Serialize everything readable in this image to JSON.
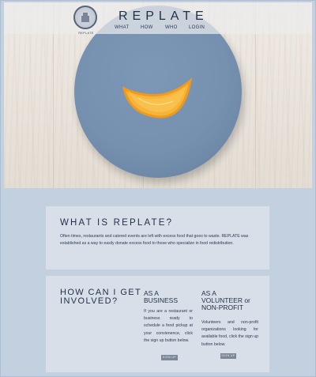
{
  "brand": {
    "name": "REPLATE",
    "logo_text": "REPLATE"
  },
  "nav": {
    "items": [
      "WHAT",
      "HOW",
      "WHO",
      "LOGIN"
    ]
  },
  "what": {
    "title": "WHAT IS REPLATE?",
    "body": "Often times, restaurants and catered events are left with excess food that goes to waste. REPLATE was established as a way to easily donate excess food to those who specialize in food redistribution."
  },
  "how": {
    "title_line1": "HOW CAN I GET",
    "title_line2": "INVOLVED?",
    "business": {
      "title_line1": "AS A",
      "title_line2": "BUSINESS",
      "body": "If you are a restaurant or business ready to schedule a food pickup at your convienence, click the sign up button below.",
      "button": "SIGN UP"
    },
    "volunteer": {
      "title_line1": "AS A",
      "title_line2": "VOLUNTEER or",
      "title_line3": "NON-PROFIT",
      "body": "Volunteers and non-profit organizations looking for available food, click the sign up button below.",
      "button": "SIGN UP"
    }
  },
  "colors": {
    "page_bg": "#c3d0e0",
    "panel_bg": "#d8dfe8",
    "plate": "#7690b0",
    "text": "#1f2f48",
    "button": "#7c8797",
    "orange": "#f2a227"
  }
}
